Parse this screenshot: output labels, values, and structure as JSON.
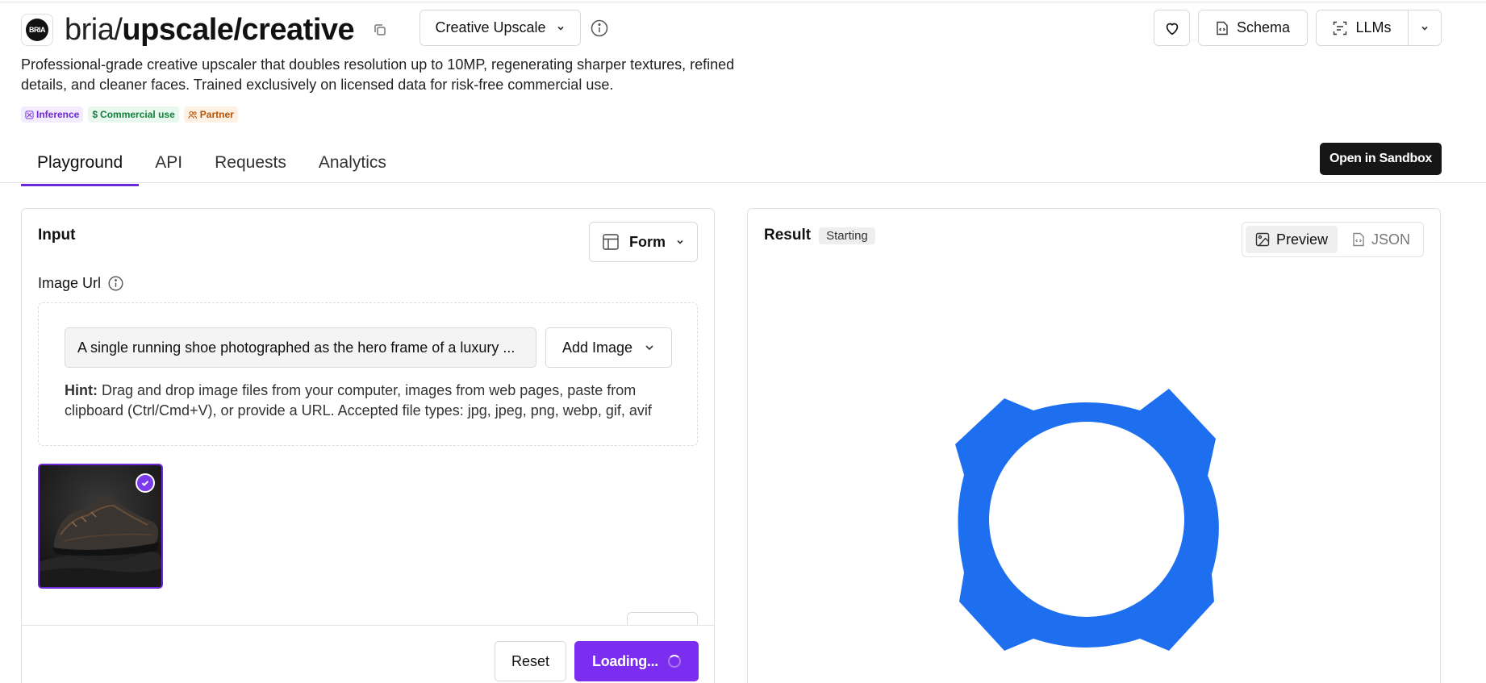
{
  "header": {
    "logo_text": "BRIA",
    "title_prefix": "bria/",
    "title_main": "upscale/creative",
    "model_select": "Creative Upscale",
    "schema_label": "Schema",
    "llms_label": "LLMs"
  },
  "description": "Professional-grade creative upscaler that doubles resolution up to 10MP, regenerating sharper textures, refined details, and cleaner faces. Trained exclusively on licensed data for risk-free commercial use.",
  "tags": [
    {
      "label": "Inference",
      "color": "#6d28d9"
    },
    {
      "label": "Commercial use",
      "color": "#15803d"
    },
    {
      "label": "Partner",
      "color": "#b45309"
    }
  ],
  "tabs": [
    {
      "label": "Playground",
      "active": true
    },
    {
      "label": "API",
      "active": false
    },
    {
      "label": "Requests",
      "active": false
    },
    {
      "label": "Analytics",
      "active": false
    }
  ],
  "sandbox_label": "Open in Sandbox",
  "input_panel": {
    "title": "Input",
    "form_label": "Form",
    "image_url_label": "Image Url",
    "image_url_value": "A single running shoe photographed as the hero frame of a luxury ...",
    "add_image_label": "Add Image",
    "hint_prefix": "Hint:",
    "hint_text": "Drag and drop image files from your computer, images from web pages, paste from clipboard (Ctrl/Cmd+V), or provide a URL. Accepted file types: jpg, jpeg, png, webp, gif, avif",
    "reset_label": "Reset",
    "loading_label": "Loading..."
  },
  "result_panel": {
    "title": "Result",
    "status": "Starting",
    "preview_label": "Preview",
    "json_label": "JSON"
  },
  "colors": {
    "accent": "#7c2ef0",
    "loader_blue": "#1e6ff0"
  }
}
